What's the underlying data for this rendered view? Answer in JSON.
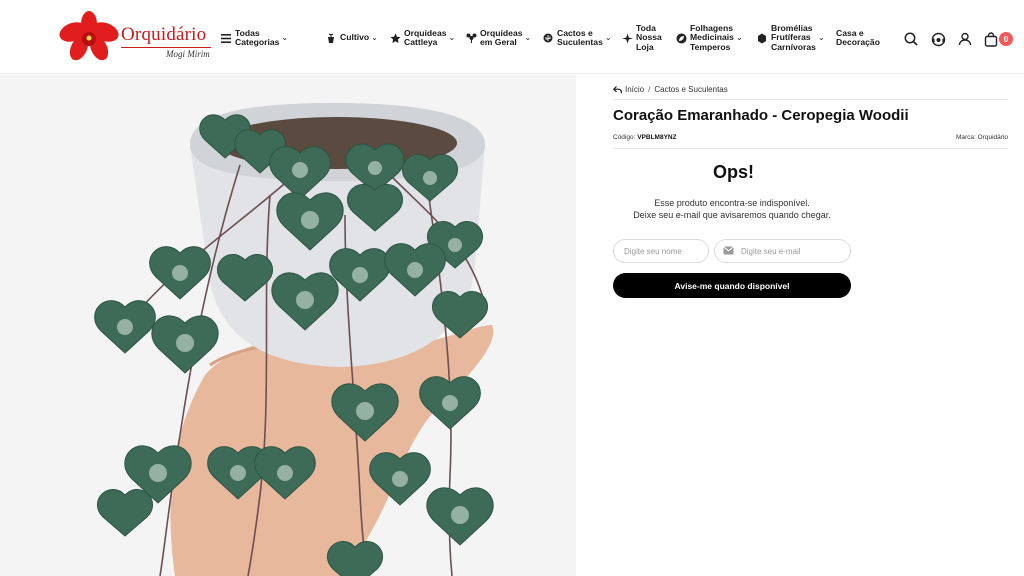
{
  "header": {
    "brand_name": "Orquidário",
    "brand_tagline": "Mogi Mirim",
    "nav": [
      {
        "label": "Todas Categorias",
        "icon": "menu-icon"
      },
      {
        "label": "Cultivo",
        "icon": "pot-icon"
      },
      {
        "label": "Orquídeas\nCattleya",
        "icon": "star-icon"
      },
      {
        "label": "Orquídeas\nem Geral",
        "icon": "orchid-icon"
      },
      {
        "label": "Cactos e\nSuculentas",
        "icon": "cactus-icon"
      },
      {
        "label": "Toda\nNossa\nLoja",
        "icon": "store-icon"
      },
      {
        "label": "Folhagens\nMedicinais\nTemperos",
        "icon": "leaf-icon"
      },
      {
        "label": "Bromélias\nFrutíferas\nCarnívoras",
        "icon": "bromeliad-icon"
      },
      {
        "label": "Casa e\nDecoração",
        "icon": "none"
      }
    ],
    "cart_count": "0",
    "accent_color": "#c81b1b"
  },
  "breadcrumb": {
    "home": "Início",
    "separator": "/",
    "category": "Cactos e Suculentas"
  },
  "product": {
    "title": "Coração Emaranhado - Ceropegia Woodii",
    "code_label": "Código:",
    "code_value": "VPBLM8YNZ",
    "brand_label": "Marca:",
    "brand_value": "Orquidário"
  },
  "unavailable": {
    "heading": "Ops!",
    "line1": "Esse produto encontra-se indisponível.",
    "line2": "Deixe seu e-mail que avisaremos quando chegar.",
    "name_placeholder": "Digite seu nome",
    "email_placeholder": "Digite seu e-mail",
    "button_label": "Avise-me quando disponível"
  }
}
